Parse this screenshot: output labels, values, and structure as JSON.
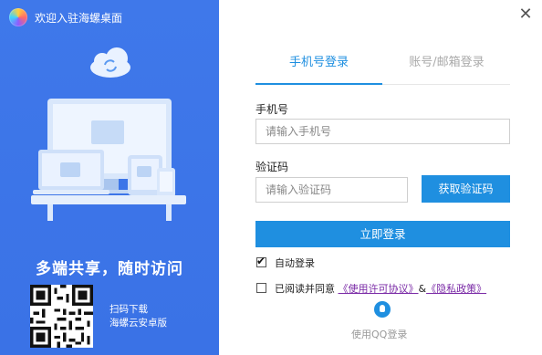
{
  "window": {
    "title": "欢迎入驻海螺桌面",
    "close_glyph": "✕"
  },
  "promo": {
    "slogan": "多端共享，随时访问",
    "qr_caption_line1": "扫码下载",
    "qr_caption_line2": "海螺云安卓版",
    "accent": "#3f78ea"
  },
  "login": {
    "tabs": [
      {
        "label": "手机号登录",
        "active": true
      },
      {
        "label": "账号/邮箱登录",
        "active": false
      }
    ],
    "phone_label": "手机号",
    "phone_placeholder": "请输入手机号",
    "code_label": "验证码",
    "code_placeholder": "请输入验证码",
    "get_code_button": "获取验证码",
    "login_button": "立即登录",
    "auto_login_label": "自动登录",
    "auto_login_checked": true,
    "agree_prefix": "已阅读并同意",
    "license_link": "《使用许可协议》",
    "amp": "&",
    "privacy_link": "《隐私政策》",
    "agree_checked": false,
    "qq_login": "使用QQ登录",
    "primary_color": "#1f8fe0"
  }
}
